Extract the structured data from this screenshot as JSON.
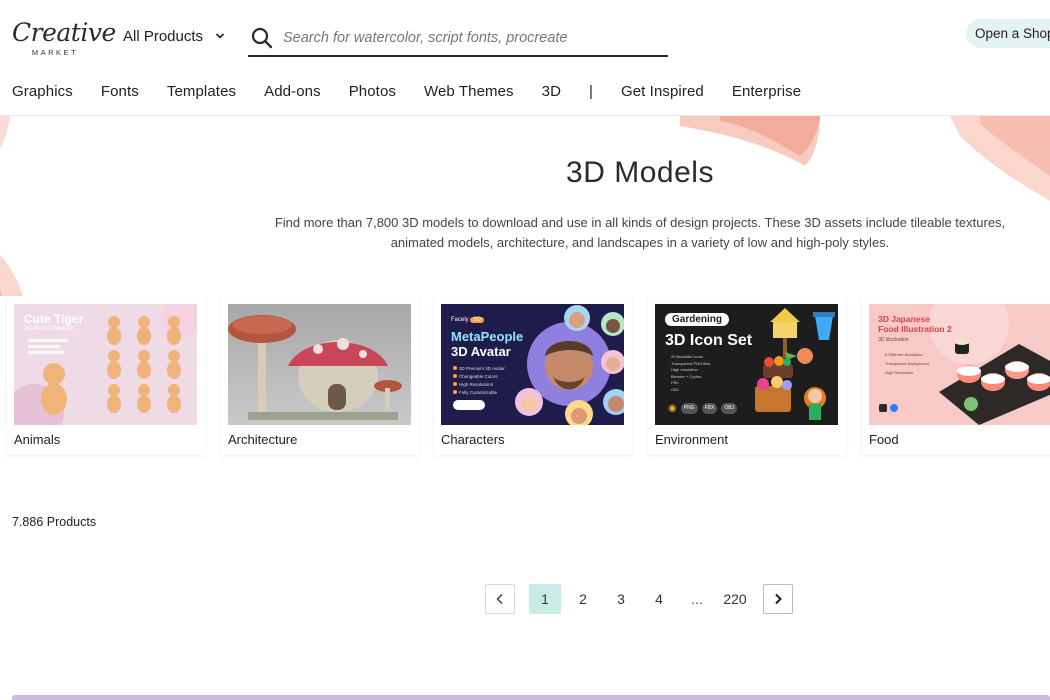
{
  "logo": {
    "main": "Creative",
    "sub": "MARKET"
  },
  "header": {
    "product_select": "All Products",
    "search_placeholder": "Search for watercolor, script fonts, procreate",
    "open_shop": "Open a Shop"
  },
  "nav": {
    "items": [
      "Graphics",
      "Fonts",
      "Templates",
      "Add-ons",
      "Photos",
      "Web Themes",
      "3D"
    ],
    "separator": "|",
    "extra": [
      "Get Inspired",
      "Enterprise"
    ]
  },
  "hero": {
    "title": "3D Models",
    "description": "Find more than 7,800 3D models to download and use in all kinds of design projects. These 3D assets include tileable textures, animated models, architecture, and landscapes in a variety of low and high-poly styles."
  },
  "categories": [
    {
      "label": "Animals",
      "thumb_title": "Cute Tiger",
      "thumb_sub": "3D Pack Character"
    },
    {
      "label": "Architecture"
    },
    {
      "label": "Characters",
      "thumb_brand": "Facely",
      "thumb_badge": "3D",
      "thumb_title": "MetaPeople",
      "thumb_title2": "3D Avatar",
      "thumb_bullets": [
        "3D Premium 3D Avatar",
        "Changeable Colors",
        "High Resolutions",
        "Fully Customizable"
      ]
    },
    {
      "label": "Environment",
      "thumb_tag": "Gardening",
      "thumb_title": "3D Icon Set",
      "thumb_bullets": [
        "20 Beautiful Icons",
        "Transparent PNG files",
        "High resolution",
        "Blender + Cycles",
        "FBX",
        "OBJ"
      ],
      "thumb_formats": [
        "PNG",
        "FBX",
        "OBJ"
      ]
    },
    {
      "label": "Food",
      "thumb_title": "3D Japanese",
      "thumb_title2": "Food Illustration 2",
      "thumb_sub": "3D Illustration",
      "thumb_bullets": [
        "8 Different Illustration",
        "Transparent Background",
        "High Resolution"
      ]
    }
  ],
  "results": {
    "count": "7.886 Products"
  },
  "pagination": {
    "pages": [
      "1",
      "2",
      "3",
      "4"
    ],
    "ellipsis": "...",
    "last": "220",
    "current": "1"
  },
  "colors": {
    "accent": "#c8ebe6",
    "shop_bg": "#e3f3f1",
    "brush": "#f6b8a8"
  }
}
